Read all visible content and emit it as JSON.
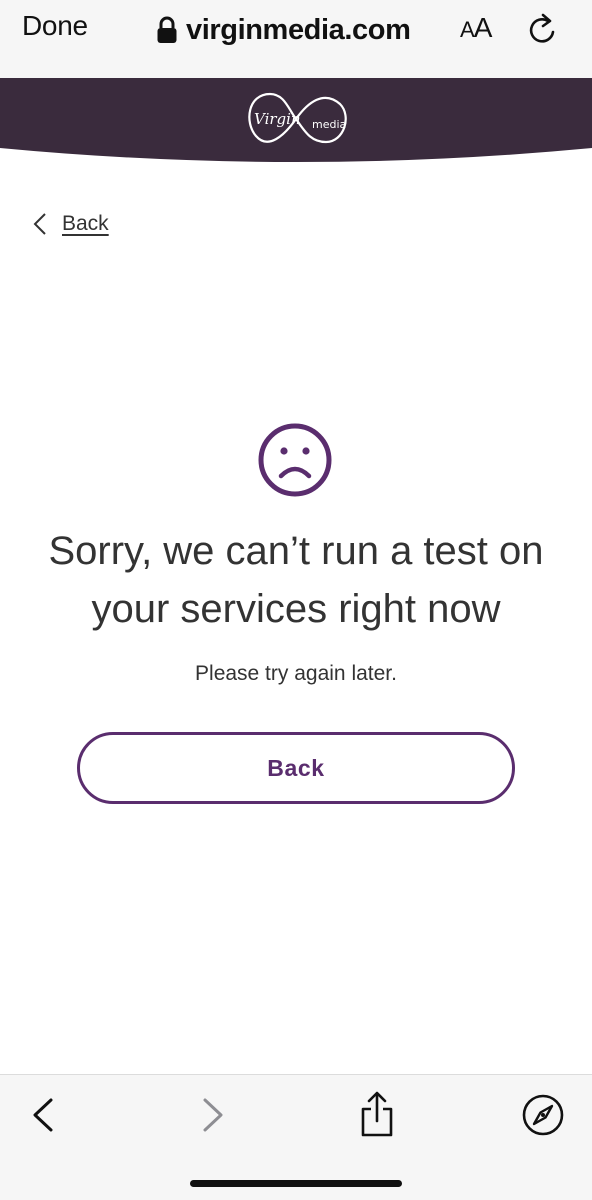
{
  "browser": {
    "done_label": "Done",
    "url": "virginmedia.com",
    "text_size_label_small": "A",
    "text_size_label_large": "A",
    "icons": {
      "lock": "lock-icon",
      "reload": "reload-icon",
      "back": "chevron-left-icon",
      "forward": "chevron-right-icon",
      "share": "share-icon",
      "compass": "compass-icon"
    }
  },
  "site": {
    "brand_primary": "Virgin",
    "brand_secondary": "media",
    "header_color": "#3a2b3d"
  },
  "nav": {
    "back_link_label": "Back"
  },
  "error": {
    "icon": "sad-face-icon",
    "headline": "Sorry, we can’t run a test on your services right now",
    "message": "Please try again later.",
    "button_label": "Back",
    "accent_color": "#5a2d6e"
  }
}
